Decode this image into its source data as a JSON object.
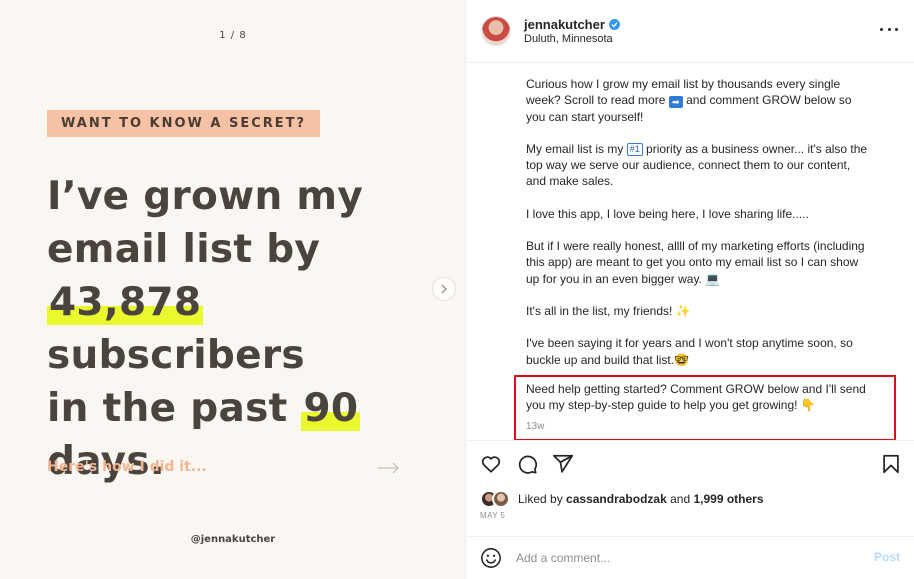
{
  "slide": {
    "counter": "1 / 8",
    "tag": "WANT TO KNOW A SECRET?",
    "headline": {
      "line1": "I’ve grown my",
      "line2": "email list by",
      "number": "43,878",
      "line3_rest": "subscribers",
      "line4_pre": "in the past",
      "days_num": "90",
      "line5": "days."
    },
    "howto": "Here's how I did it...",
    "handle": "@jennakutcher"
  },
  "post": {
    "username": "jennakutcher",
    "location": "Duluth, Minnesota",
    "caption": {
      "p1_a": "Curious how I grow my email list by thousands every single week? Scroll to read more",
      "p1_arrow": "➡",
      "p1_b": "and comment GROW below so you can start yourself!",
      "p2_a": "My email list is my",
      "p2_badge": "#1",
      "p2_b": "priority as a business owner... it's also the top way we serve our audience, connect them to our content, and make sales.",
      "p3": "I love this app, I love being here, I love sharing life.....",
      "p4": "But if I were really honest, allll of my marketing efforts (including this app) are meant to get you onto my email list so I can show up for you in an even bigger way.",
      "p4_emoji": "💻",
      "p5": "It's all in the list, my friends!",
      "p5_emoji": "✨",
      "p6": "I've been saying it for years and I won't stop anytime soon, so buckle up and build that list.",
      "p6_emoji": "🤓",
      "p7": "Need help getting started? Comment GROW below and I'll send you my step-by-step guide to help you get growing!",
      "p7_emoji": "👇"
    },
    "age": "13w",
    "likes": {
      "prefix": "Liked by",
      "user": "cassandrabodzak",
      "mid": "and",
      "count": "1,999 others"
    },
    "date": "MAY 5",
    "comment_placeholder": "Add a comment...",
    "post_label": "Post"
  },
  "colors": {
    "tag_bg": "#f6c2a6",
    "highlight": "#e9f92e",
    "howto": "#f2b58f",
    "red_box": "#d9101c",
    "verified": "#3897f0"
  },
  "icons": [
    "chevron-right-icon",
    "arrow-right-icon",
    "verified-icon",
    "more-icon",
    "heart-icon",
    "comment-icon",
    "share-icon",
    "bookmark-icon",
    "smiley-icon"
  ]
}
